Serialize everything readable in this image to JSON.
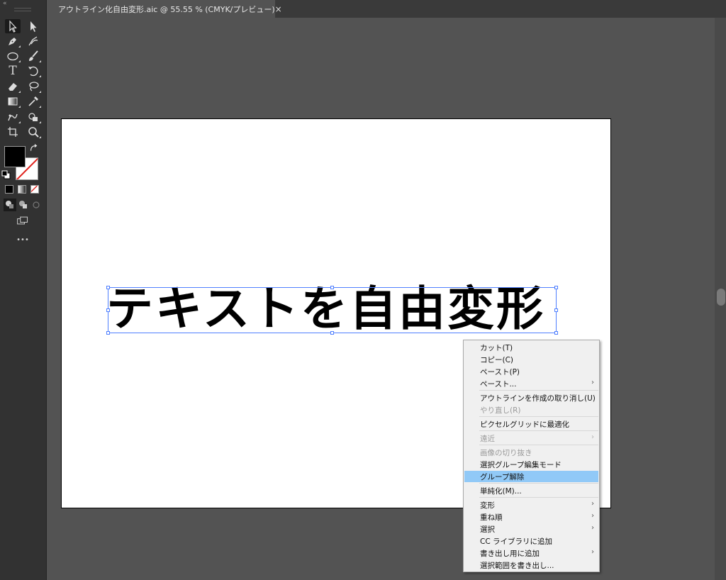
{
  "document_tab": {
    "title": "アウトライン化自由変形.aic @ 55.55 % (CMYK/プレビュー)",
    "close_glyph": "×"
  },
  "toolbar": {
    "collapse_glyph": "«",
    "more_glyph": "•••",
    "tools": [
      "selection-tool",
      "direct-selection-tool",
      "pen-tool",
      "curvature-tool",
      "ellipse-tool",
      "paintbrush-tool",
      "type-tool",
      "rotate-tool",
      "eraser-tool",
      "lasso-tool",
      "gradient-tool",
      "eyedropper-tool",
      "puppet-warp-tool",
      "shape-builder-tool",
      "artboard-tool",
      "zoom-tool"
    ],
    "type_glyph": "T",
    "fill_color": "#000000",
    "stroke_color": "none"
  },
  "canvas": {
    "selected_text": "テキストを自由変形",
    "selection_color": "#4f7fff"
  },
  "context_menu": {
    "items": [
      {
        "label": "カット(T)",
        "enabled": true
      },
      {
        "label": "コピー(C)",
        "enabled": true
      },
      {
        "label": "ペースト(P)",
        "enabled": true
      },
      {
        "label": "ペースト...",
        "enabled": true,
        "submenu": true
      },
      {
        "label": "アウトラインを作成の取り消し(U)",
        "enabled": true
      },
      {
        "label": "やり直し(R)",
        "enabled": false
      },
      {
        "label": "ピクセルグリッドに最適化",
        "enabled": true
      },
      {
        "label": "遠近",
        "enabled": false,
        "submenu": true
      },
      {
        "label": "画像の切り抜き",
        "enabled": false
      },
      {
        "label": "選択グループ編集モード",
        "enabled": true
      },
      {
        "label": "グループ解除",
        "enabled": true,
        "highlighted": true
      },
      {
        "label": "単純化(M)...",
        "enabled": true
      },
      {
        "label": "変形",
        "enabled": true,
        "submenu": true
      },
      {
        "label": "重ね順",
        "enabled": true,
        "submenu": true
      },
      {
        "label": "選択",
        "enabled": true,
        "submenu": true
      },
      {
        "label": "CC ライブラリに追加",
        "enabled": true
      },
      {
        "label": "書き出し用に追加",
        "enabled": true,
        "submenu": true
      },
      {
        "label": "選択範囲を書き出し...",
        "enabled": true
      }
    ],
    "submenu_glyph": "›",
    "highlight_color": "#91c9f7"
  }
}
